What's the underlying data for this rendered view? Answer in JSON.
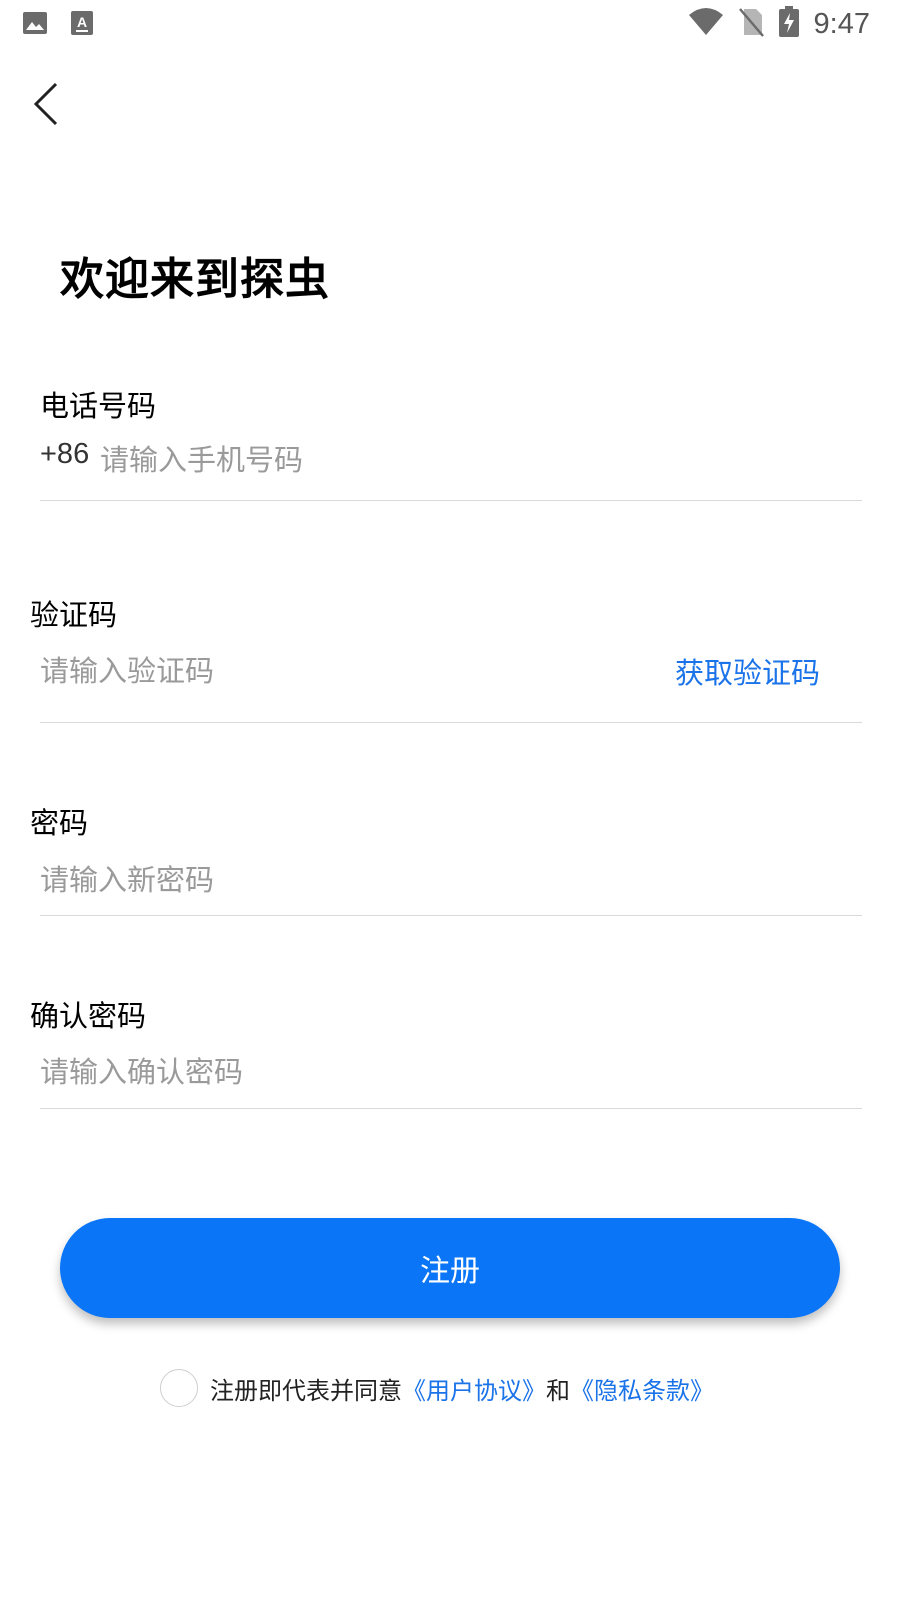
{
  "status_bar": {
    "time": "9:47",
    "icons": [
      "image-icon",
      "a-note-icon",
      "wifi-icon",
      "no-sim-icon",
      "battery-charging-icon"
    ]
  },
  "header": {
    "back_icon": "chevron-left-icon"
  },
  "title": "欢迎来到探虫",
  "phone": {
    "label": "电话号码",
    "country_code": "+86",
    "placeholder": "请输入手机号码",
    "value": ""
  },
  "code": {
    "label": "验证码",
    "placeholder": "请输入验证码",
    "value": "",
    "get_code_label": "获取验证码"
  },
  "password": {
    "label": "密码",
    "placeholder": "请输入新密码",
    "value": ""
  },
  "confirm_password": {
    "label": "确认密码",
    "placeholder": "请输入确认密码",
    "value": ""
  },
  "register_button": "注册",
  "agreement": {
    "prefix": "注册即代表并同意",
    "user_agreement": "《用户协议》",
    "and": "和",
    "privacy_policy": "《隐私条款》",
    "checked": false
  },
  "colors": {
    "accent": "#0a76f7",
    "link": "#1a73e8",
    "placeholder": "#9a9a9a",
    "divider": "#d9d9d9"
  }
}
